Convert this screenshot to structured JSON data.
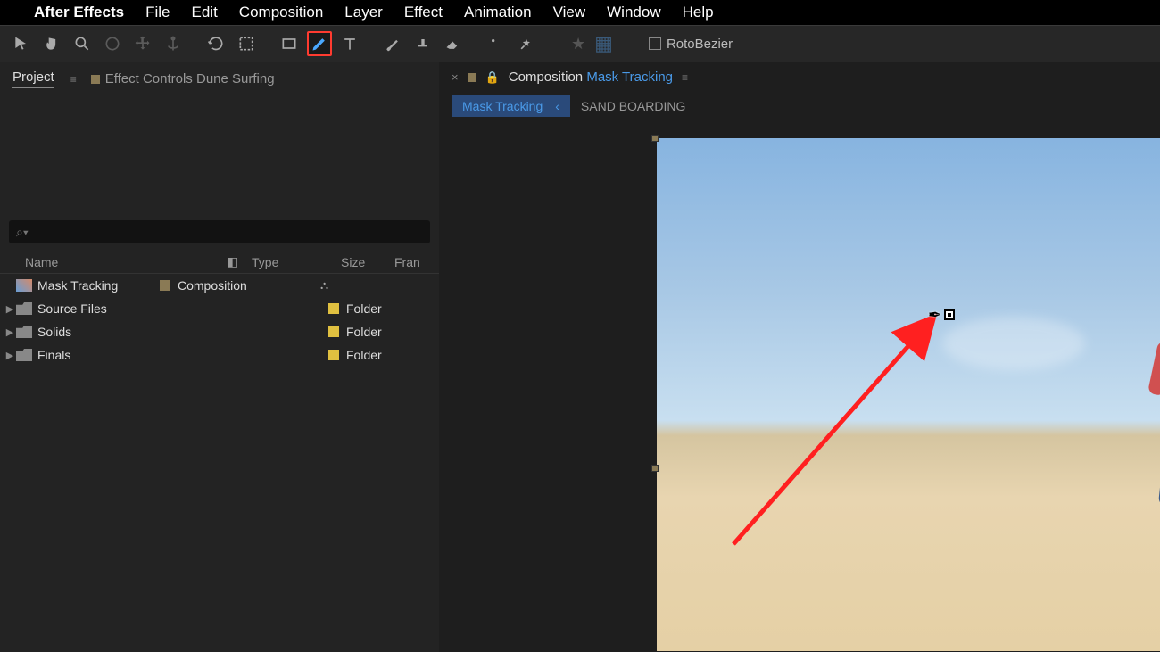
{
  "menubar": {
    "appname": "After Effects",
    "items": [
      "File",
      "Edit",
      "Composition",
      "Layer",
      "Effect",
      "Animation",
      "View",
      "Window",
      "Help"
    ]
  },
  "toolbar": {
    "rotobezier_label": "RotoBezier"
  },
  "project_panel": {
    "project_tab": "Project",
    "effect_controls_label": "Effect Controls",
    "effect_controls_target": "Dune Surfing",
    "search_placeholder": "⌕▾",
    "columns": {
      "name": "Name",
      "type": "Type",
      "size": "Size",
      "fr": "Fran"
    },
    "rows": [
      {
        "name": "Mask Tracking",
        "type": "Composition",
        "tag": "tan",
        "icon": "comp",
        "expandable": false,
        "flow": true
      },
      {
        "name": "Source Files",
        "type": "Folder",
        "tag": "yellow",
        "icon": "folder",
        "expandable": true
      },
      {
        "name": "Solids",
        "type": "Folder",
        "tag": "yellow",
        "icon": "folder",
        "expandable": true
      },
      {
        "name": "Finals",
        "type": "Folder",
        "tag": "yellow",
        "icon": "folder",
        "expandable": true
      }
    ]
  },
  "composition_panel": {
    "static_label": "Composition",
    "comp_name": "Mask Tracking",
    "breadcrumb": {
      "active": "Mask Tracking",
      "inactive": "SAND BOARDING"
    }
  }
}
